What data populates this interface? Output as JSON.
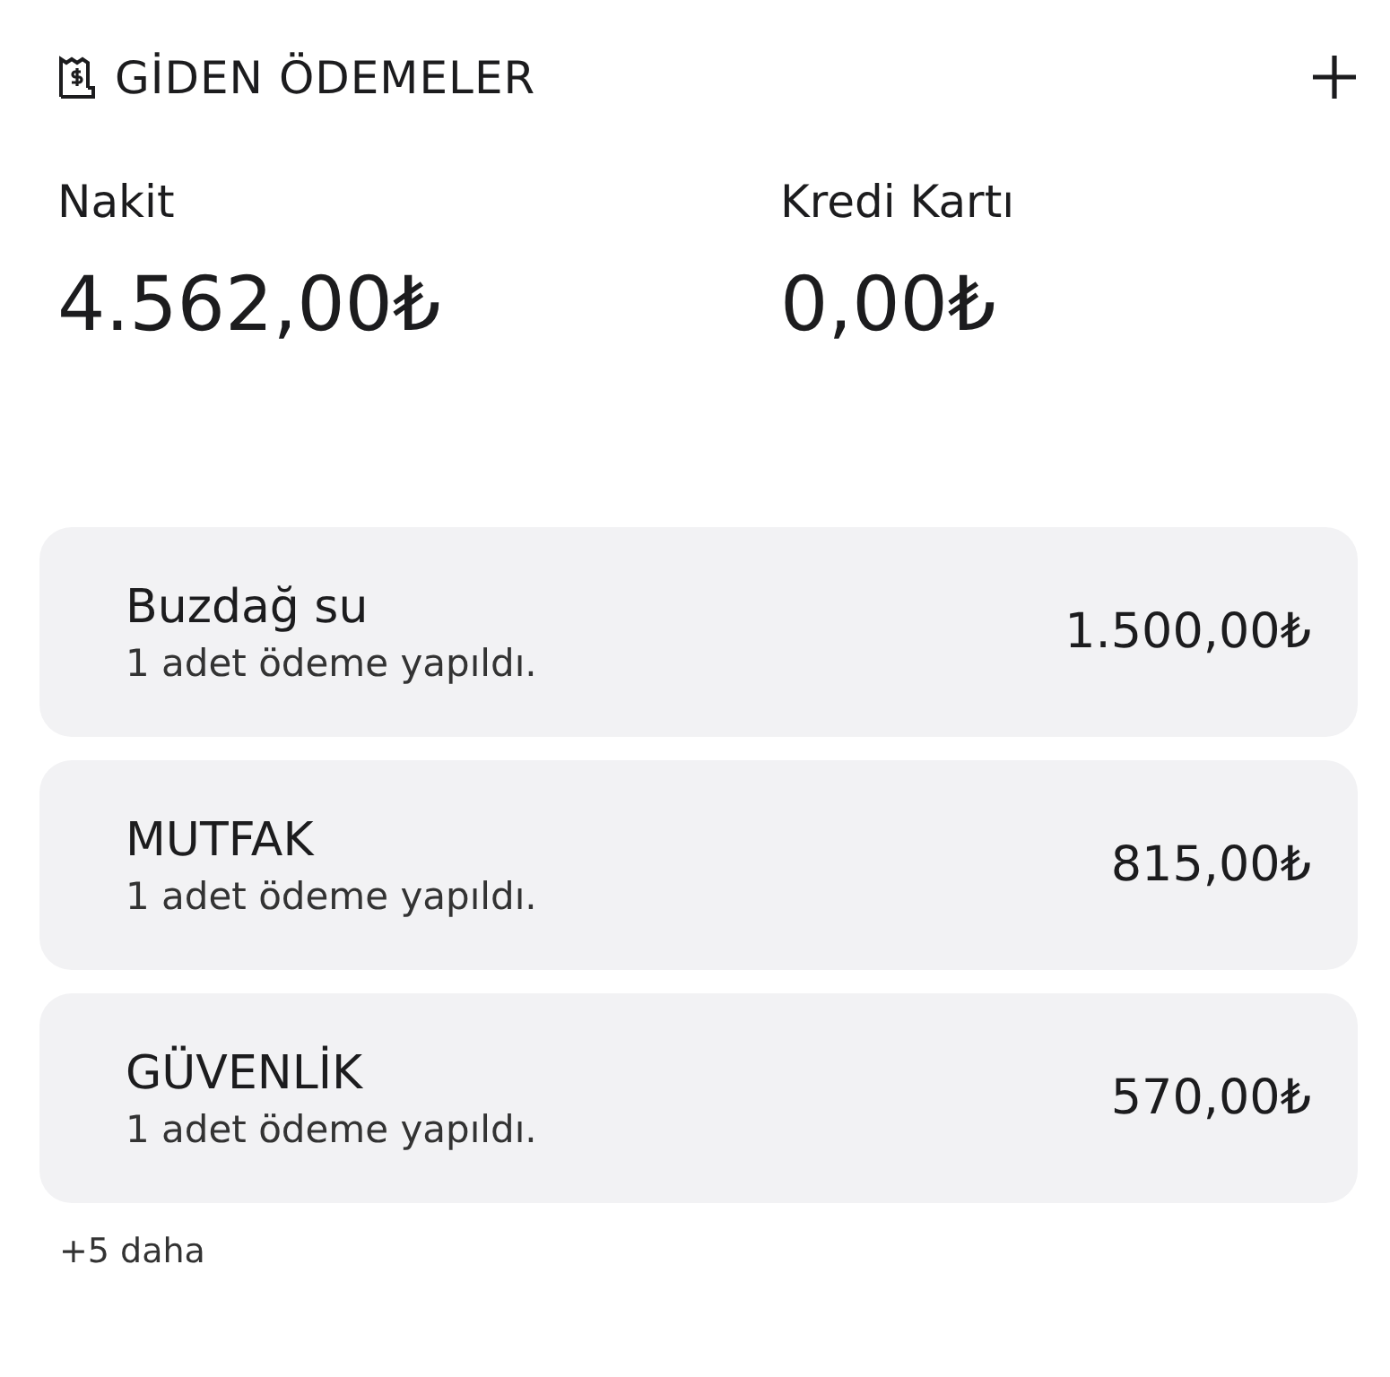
{
  "header": {
    "title": "GİDEN ÖDEMELER"
  },
  "totals": [
    {
      "label": "Nakit",
      "amount": "4.562,00₺"
    },
    {
      "label": "Kredi Kartı",
      "amount": "0,00₺"
    }
  ],
  "payments": [
    {
      "name": "Buzdağ su",
      "detail": "1 adet ödeme yapıldı.",
      "amount": "1.500,00₺"
    },
    {
      "name": "MUTFAK",
      "detail": "1 adet ödeme yapıldı.",
      "amount": "815,00₺"
    },
    {
      "name": "GÜVENLİK",
      "detail": "1 adet ödeme yapıldı.",
      "amount": "570,00₺"
    }
  ],
  "more": "+5 daha"
}
